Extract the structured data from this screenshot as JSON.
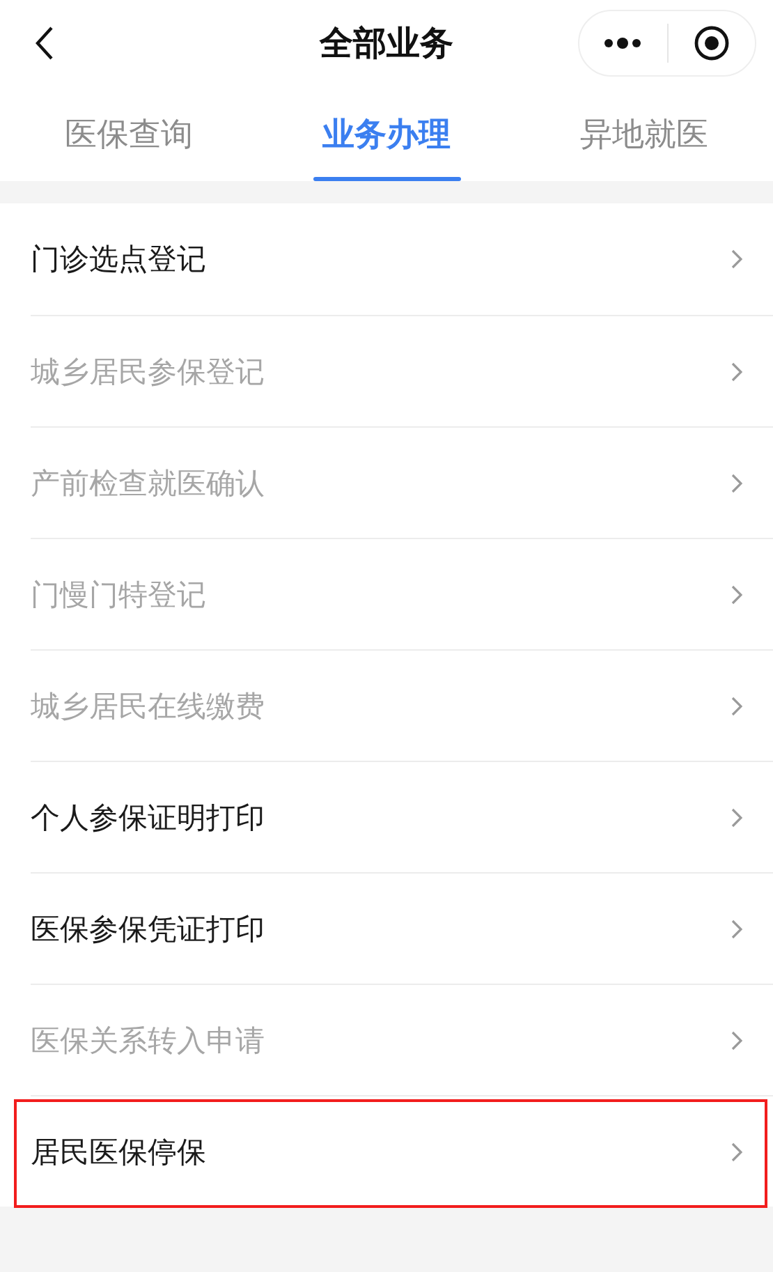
{
  "header": {
    "title": "全部业务"
  },
  "tabs": [
    {
      "label": "医保查询",
      "selected": false
    },
    {
      "label": "业务办理",
      "selected": true
    },
    {
      "label": "异地就医",
      "selected": false
    }
  ],
  "items": [
    {
      "label": "门诊选点登记",
      "disabled": false,
      "highlighted": false
    },
    {
      "label": "城乡居民参保登记",
      "disabled": true,
      "highlighted": false
    },
    {
      "label": "产前检查就医确认",
      "disabled": true,
      "highlighted": false
    },
    {
      "label": "门慢门特登记",
      "disabled": true,
      "highlighted": false
    },
    {
      "label": "城乡居民在线缴费",
      "disabled": true,
      "highlighted": false
    },
    {
      "label": "个人参保证明打印",
      "disabled": false,
      "highlighted": false
    },
    {
      "label": "医保参保凭证打印",
      "disabled": false,
      "highlighted": false
    },
    {
      "label": "医保关系转入申请",
      "disabled": true,
      "highlighted": false
    },
    {
      "label": "居民医保停保",
      "disabled": false,
      "highlighted": true
    }
  ]
}
